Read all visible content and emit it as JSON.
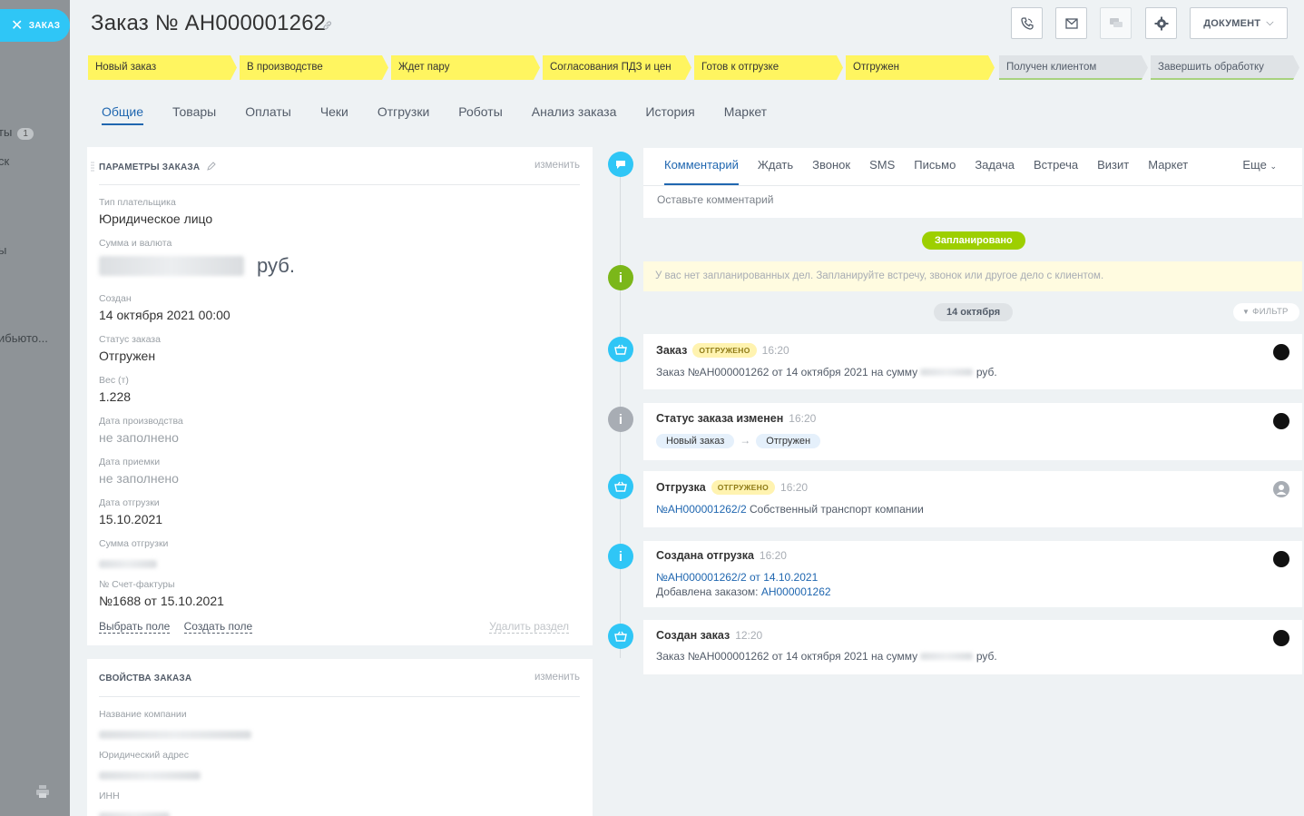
{
  "sidebar": {
    "close_label": "ЗАКАЗ",
    "partial_text_1": "ты",
    "partial_badge": "1",
    "partial_text_2": "ск",
    "partial_text_3": "ы",
    "partial_text_4": "ибьюто..."
  },
  "header": {
    "title": "Заказ №  АН000001262",
    "document_button": "ДОКУМЕНТ"
  },
  "stages": [
    {
      "label": "Новый заказ",
      "state": "active"
    },
    {
      "label": "В производстве",
      "state": "active"
    },
    {
      "label": "Ждет пару",
      "state": "active"
    },
    {
      "label": "Согласования ПДЗ и цен",
      "state": "active"
    },
    {
      "label": "Готов к отгрузке",
      "state": "active"
    },
    {
      "label": "Отгружен",
      "state": "active"
    },
    {
      "label": "Получен клиентом",
      "state": "inactive"
    },
    {
      "label": "Завершить обработку",
      "state": "inactive"
    }
  ],
  "tabs": [
    "Общие",
    "Товары",
    "Оплаты",
    "Чеки",
    "Отгрузки",
    "Роботы",
    "Анализ заказа",
    "История",
    "Маркет"
  ],
  "order_params": {
    "title": "ПАРАМЕТРЫ ЗАКАЗА",
    "edit_label": "изменить",
    "fields": {
      "payer_type": {
        "label": "Тип плательщика",
        "value": "Юридическое лицо"
      },
      "amount": {
        "label": "Сумма и валюта",
        "currency": "руб."
      },
      "created": {
        "label": "Создан",
        "value": "14 октября 2021 00:00"
      },
      "status": {
        "label": "Статус заказа",
        "value": "Отгружен"
      },
      "weight": {
        "label": "Вес (т)",
        "value": "1.228"
      },
      "production_date": {
        "label": "Дата производства",
        "value": "не заполнено"
      },
      "accept_date": {
        "label": "Дата приемки",
        "value": "не заполнено"
      },
      "ship_date": {
        "label": "Дата отгрузки",
        "value": "15.10.2021"
      },
      "ship_sum": {
        "label": "Сумма отгрузки"
      },
      "invoice": {
        "label": "№ Счет-фактуры",
        "value": "№1688 от 15.10.2021"
      }
    },
    "select_field": "Выбрать поле",
    "create_field": "Создать поле",
    "delete_section": "Удалить раздел"
  },
  "order_props": {
    "title": "СВОЙСТВА ЗАКАЗА",
    "edit_label": "изменить",
    "fields": {
      "company": {
        "label": "Название компании"
      },
      "address": {
        "label": "Юридический адрес"
      },
      "inn": {
        "label": "ИНН"
      }
    }
  },
  "composer": {
    "tabs": [
      "Комментарий",
      "Ждать",
      "Звонок",
      "SMS",
      "Письмо",
      "Задача",
      "Встреча",
      "Визит",
      "Маркет"
    ],
    "more": "Еще",
    "placeholder": "Оставьте комментарий"
  },
  "timeline": {
    "planned_label": "Запланировано",
    "notice": "У вас нет запланированных дел. Запланируйте встречу, звонок или другое дело с клиентом.",
    "date_label": "14 октября",
    "filter_label": "ФИЛЬТР",
    "items": {
      "order": {
        "title": "Заказ",
        "badge": "ОТГРУЖЕНО",
        "time": "16:20",
        "body_prefix": "Заказ №АН000001262 от 14 октября 2021 на сумму",
        "body_suffix": "руб."
      },
      "status_changed": {
        "title": "Статус заказа изменен",
        "time": "16:20",
        "from": "Новый заказ",
        "to": "Отгружен"
      },
      "shipment": {
        "title": "Отгрузка",
        "badge": "ОТГРУЖЕНО",
        "time": "16:20",
        "link": "№АН000001262/2",
        "text": "Собственный транспорт компании"
      },
      "shipment_created": {
        "title": "Создана отгрузка",
        "time": "16:20",
        "link": "№АН000001262/2 от 14.10.2021",
        "added_by": "Добавлена заказом:",
        "order_link": "АН000001262"
      },
      "order_created": {
        "title": "Создан заказ",
        "time": "12:20",
        "body_prefix": "Заказ №АН000001262 от 14 октября 2021 на сумму",
        "body_suffix": "руб."
      }
    }
  },
  "colors": {
    "accent": "#2067b0",
    "stage_active": "#fff560",
    "stage_inactive": "#dfe3e6",
    "timeline_blue": "#2fc6f6",
    "timeline_green": "#7bb719",
    "planned_pill": "#9dcf00"
  }
}
